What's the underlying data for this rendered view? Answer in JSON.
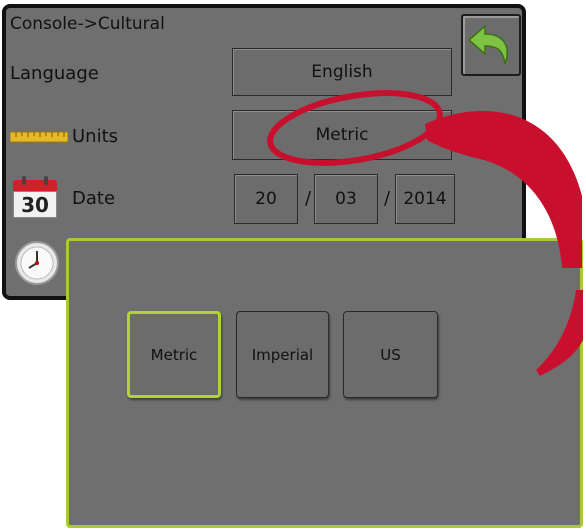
{
  "console": {
    "breadcrumb": "Console->Cultural",
    "language": {
      "label": "Language",
      "value": "English"
    },
    "units": {
      "label": "Units",
      "value": "Metric"
    },
    "date": {
      "label": "Date",
      "calendar_day": "30",
      "day": "20",
      "separator": "/",
      "month": "03",
      "year": "2014"
    },
    "back_icon": "return-arrow-icon"
  },
  "overlay": {
    "options": [
      {
        "label": "Metric",
        "selected": true
      },
      {
        "label": "Imperial",
        "selected": false
      },
      {
        "label": "US",
        "selected": false
      }
    ]
  },
  "colors": {
    "panel": "#6f6f70",
    "selection_border": "#b2d235",
    "callout": "#c8102e",
    "back_arrow": "#7dc242"
  }
}
